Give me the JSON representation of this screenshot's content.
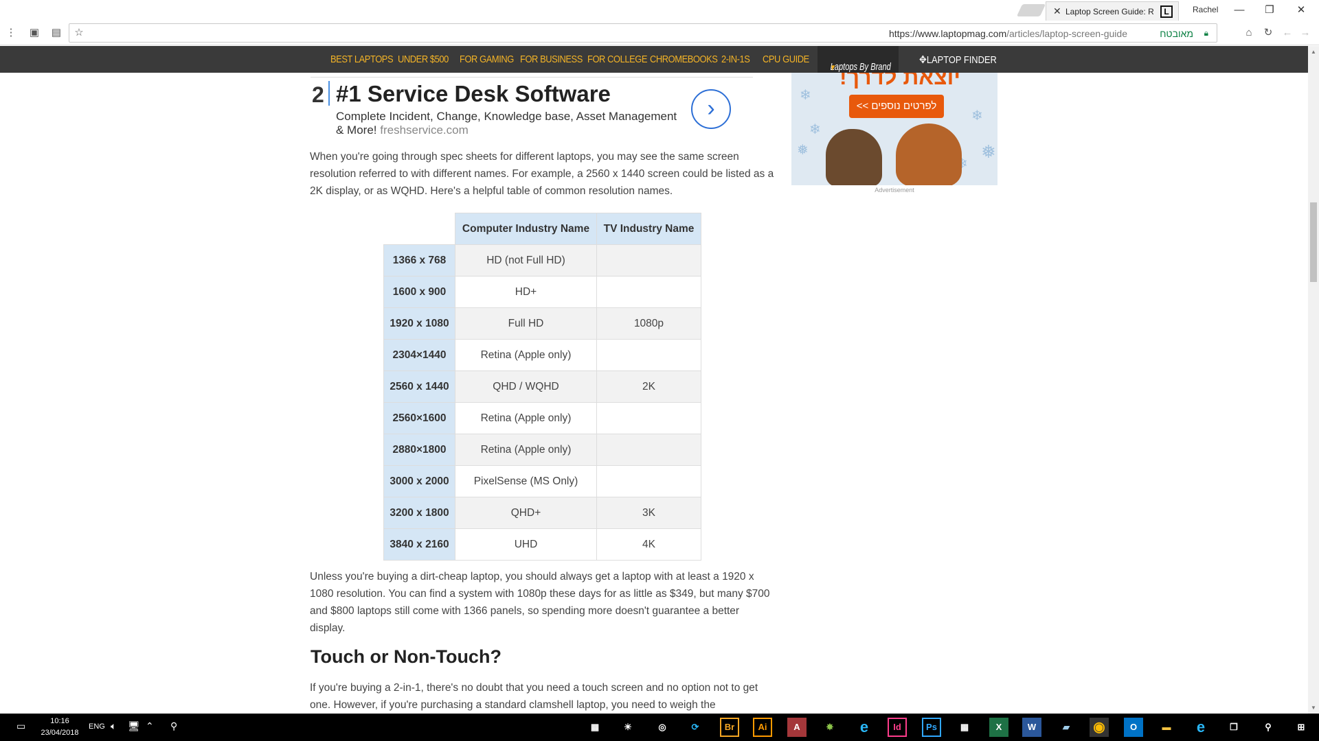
{
  "browser": {
    "tab_title": "Laptop Screen Guide: Re",
    "tab_favicon_letter": "L",
    "profile": "Rachel",
    "url_host": "https://www.laptopmag.com",
    "url_path": "/articles/laptop-screen-guide",
    "secure_label": "מאובטח"
  },
  "nav": {
    "items": [
      "BEST LAPTOPS",
      "UNDER $500",
      "FOR GAMING",
      "FOR BUSINESS",
      "FOR COLLEGE",
      "CHROMEBOOKS",
      "2-IN-1S",
      "CPU GUIDE"
    ],
    "brand": "Laptops By Brand",
    "finder": "LAPTOP FINDER"
  },
  "ad": {
    "number": "2",
    "title": "#1 Service Desk Software",
    "description": "Complete Incident, Change, Knowledge base, Asset Management & More!",
    "domain": "freshservice.com"
  },
  "side_ad": {
    "headline": "יוצאת לדרך!",
    "button": "לפרטים נוספים >>",
    "label": "Advertisement"
  },
  "article": {
    "para1": "When you're going through spec sheets for different laptops, you may see the same screen resolution referred to with different names. For example, a 2560 x 1440 screen could be listed as a 2K display, or as WQHD. Here's a helpful table of common resolution names.",
    "table": {
      "headers": [
        "Computer Industry Name",
        "TV Industry Name"
      ],
      "rows": [
        {
          "res": "1366 x 768",
          "computer": "HD (not Full HD)",
          "tv": ""
        },
        {
          "res": "1600 x 900",
          "computer": "HD+",
          "tv": ""
        },
        {
          "res": "1920 x 1080",
          "computer": "Full HD",
          "tv": "1080p"
        },
        {
          "res": "2304×1440",
          "computer": "Retina (Apple only)",
          "tv": ""
        },
        {
          "res": "2560 x 1440",
          "computer": "QHD / WQHD",
          "tv": "2K"
        },
        {
          "res": "2560×1600",
          "computer": "Retina (Apple only)",
          "tv": ""
        },
        {
          "res": "2880×1800",
          "computer": "Retina (Apple only)",
          "tv": ""
        },
        {
          "res": "3000 x 2000",
          "computer": "PixelSense (MS Only)",
          "tv": ""
        },
        {
          "res": "3200 x 1800",
          "computer": "QHD+",
          "tv": "3K"
        },
        {
          "res": "3840 x 2160",
          "computer": "UHD",
          "tv": "4K"
        }
      ]
    },
    "para2": "Unless you're buying a dirt-cheap laptop, you should always get a laptop with at least a 1920 x 1080 resolution. You can find a system with 1080p these days for as little as $349, but many $700 and $800 laptops still come with 1366 panels, so spending more doesn't guarantee a better display.",
    "heading2": "Touch or Non-Touch?",
    "para3": "If you're buying a 2-in-1, there's no doubt that you need a touch screen and no option not to get one. However, if you're purchasing a standard clamshell laptop, you need to weigh the"
  },
  "taskbar": {
    "time": "10:16",
    "date": "23/04/2018",
    "lang": "ENG",
    "apps": [
      "Br",
      "Ai",
      "A",
      "e",
      "Id",
      "Ps",
      "X",
      "W",
      "O"
    ]
  },
  "colors": {
    "nav_bg": "#3a3a3a",
    "nav_text": "#f3b326",
    "table_header": "#d5e6f5",
    "link_blue": "#2d6fd6",
    "ad_orange": "#e8590c"
  }
}
